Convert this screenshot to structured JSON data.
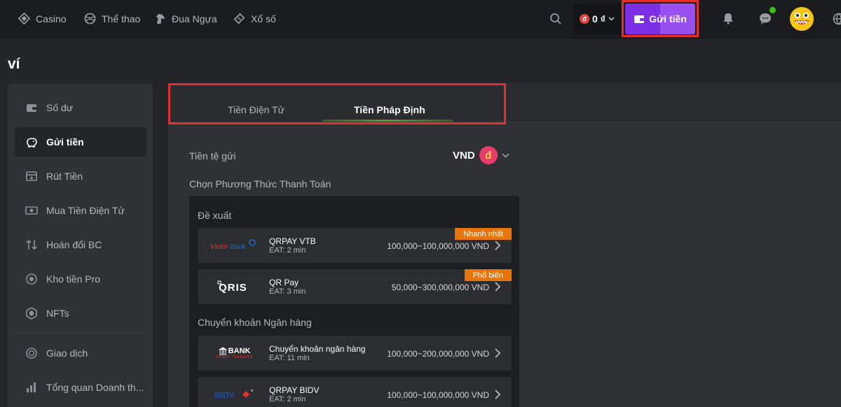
{
  "nav": {
    "items": [
      {
        "label": "Casino",
        "icon": "diamond-icon"
      },
      {
        "label": "Thể thao",
        "icon": "ball-icon"
      },
      {
        "label": "Đua Ngựa",
        "icon": "horse-icon"
      },
      {
        "label": "Xổ số",
        "icon": "lottery-icon"
      }
    ],
    "balance": "0",
    "balance_symbol": "₫",
    "deposit_label": "Gửi tiền"
  },
  "page": {
    "title": "ví"
  },
  "sidebar": {
    "items": [
      {
        "label": "Số dư",
        "icon": "wallet-icon"
      },
      {
        "label": "Gửi tiền",
        "icon": "piggy-bank-icon"
      },
      {
        "label": "Rút Tiền",
        "icon": "withdraw-icon"
      },
      {
        "label": "Mua Tiền Điện Tử",
        "icon": "buy-crypto-icon"
      },
      {
        "label": "Hoán đổi BC",
        "icon": "swap-icon"
      },
      {
        "label": "Kho tiền Pro",
        "icon": "vault-icon"
      },
      {
        "label": "NFTs",
        "icon": "nft-icon"
      },
      {
        "label": "Giao dịch",
        "icon": "transactions-icon"
      },
      {
        "label": "Tổng quan Doanh th...",
        "icon": "chart-icon"
      }
    ]
  },
  "tabs": [
    {
      "label": "Tiền Điện Tử"
    },
    {
      "label": "Tiền Pháp Định"
    }
  ],
  "deposit": {
    "currency_label": "Tiền tệ gửi",
    "currency_code": "VND",
    "currency_symbol": "đ",
    "method_label": "Chọn Phương Thức Thanh Toán",
    "recommended_title": "Đề xuất",
    "bank_title": "Chuyển khoản Ngân hàng",
    "methods": [
      {
        "name": "QRPAY VTB",
        "eat": "EAT: 2 min",
        "range": "100,000~100,000,000 VND",
        "tag": "Nhanh nhất",
        "logo": "VietinBank"
      },
      {
        "name": "QR Pay",
        "eat": "EAT: 3 min",
        "range": "50,000~300,000,000 VND",
        "tag": "Phổ biến",
        "logo": "QRIS"
      },
      {
        "name": "Chuyển khoản ngân hàng",
        "eat": "EAT: 11 min",
        "range": "100,000~200,000,000 VND",
        "logo": "BANK",
        "logo_sub": "MONEY TRANSFER"
      },
      {
        "name": "QRPAY BIDV",
        "eat": "EAT: 2 min",
        "range": "100,000~100,000,000 VND",
        "logo": "BIDV"
      }
    ]
  },
  "colors": {
    "accent": "#7e2ee5",
    "highlight_outline": "#e32e2e",
    "tag": "#e8740a",
    "online": "#3bc117"
  }
}
